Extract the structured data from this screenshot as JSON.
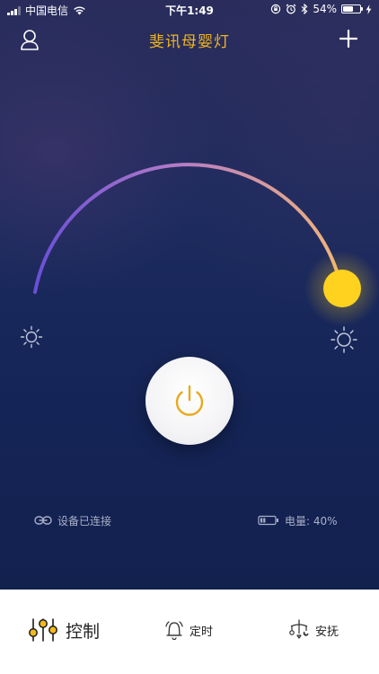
{
  "status_bar": {
    "carrier": "中国电信",
    "time": "下午1:49",
    "battery_percent": "54%"
  },
  "nav": {
    "title": "斐讯母婴灯"
  },
  "brightness": {
    "level_fraction": 1.0
  },
  "power": {
    "state": "off"
  },
  "info": {
    "connection_status": "设备已连接",
    "battery_label": "电量: 40%"
  },
  "tabs": [
    {
      "label": "控制",
      "icon": "control-sliders-icon",
      "active": true
    },
    {
      "label": "定时",
      "icon": "bell-icon",
      "active": false
    },
    {
      "label": "安抚",
      "icon": "mobile-toy-icon",
      "active": false
    }
  ],
  "colors": {
    "title_accent": "#f2b51f",
    "power_accent": "#e8a91c",
    "arc_start": "#6a4fd6",
    "arc_mid": "#b37ac8",
    "arc_end": "#f2b57a",
    "knob": "#ffd21f"
  }
}
